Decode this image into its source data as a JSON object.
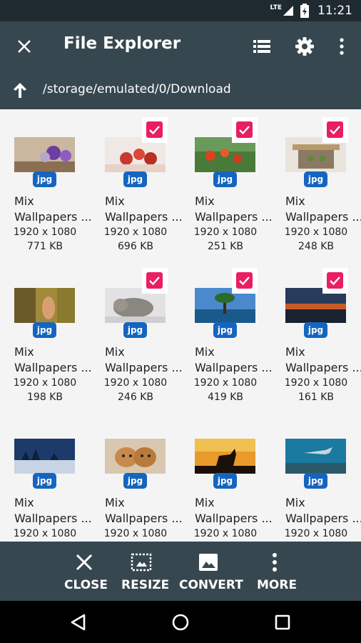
{
  "status_bar": {
    "network": "LTE",
    "time": "11:21"
  },
  "app_bar": {
    "title": "File Explorer",
    "icons": [
      "close-icon",
      "list-view-icon",
      "gear-icon",
      "more-vert-icon"
    ]
  },
  "path_bar": {
    "path": "/storage/emulated/0/Download",
    "icon": "arrow-up-icon"
  },
  "files": [
    {
      "name1": "Mix",
      "name2": "Wallpapers ...",
      "resolution": "1920 x 1080",
      "size": "771 KB",
      "type": "jpg",
      "checked": false
    },
    {
      "name1": "Mix",
      "name2": "Wallpapers ...",
      "resolution": "1920 x 1080",
      "size": "696 KB",
      "type": "jpg",
      "checked": true
    },
    {
      "name1": "Mix",
      "name2": "Wallpapers ...",
      "resolution": "1920 x 1080",
      "size": "251 KB",
      "type": "jpg",
      "checked": true
    },
    {
      "name1": "Mix",
      "name2": "Wallpapers ...",
      "resolution": "1920 x 1080",
      "size": "248 KB",
      "type": "jpg",
      "checked": true
    },
    {
      "name1": "Mix",
      "name2": "Wallpapers ...",
      "resolution": "1920 x 1080",
      "size": "198 KB",
      "type": "jpg",
      "checked": false
    },
    {
      "name1": "Mix",
      "name2": "Wallpapers ...",
      "resolution": "1920 x 1080",
      "size": "246 KB",
      "type": "jpg",
      "checked": true
    },
    {
      "name1": "Mix",
      "name2": "Wallpapers ...",
      "resolution": "1920 x 1080",
      "size": "419 KB",
      "type": "jpg",
      "checked": true
    },
    {
      "name1": "Mix",
      "name2": "Wallpapers ...",
      "resolution": "1920 x 1080",
      "size": "161 KB",
      "type": "jpg",
      "checked": true
    },
    {
      "name1": "Mix",
      "name2": "Wallpapers ...",
      "resolution": "1920 x 1080",
      "size": "",
      "type": "jpg",
      "checked": false
    },
    {
      "name1": "Mix",
      "name2": "Wallpapers ...",
      "resolution": "1920 x 1080",
      "size": "",
      "type": "jpg",
      "checked": false
    },
    {
      "name1": "Mix",
      "name2": "Wallpapers ...",
      "resolution": "1920 x 1080",
      "size": "",
      "type": "jpg",
      "checked": false
    },
    {
      "name1": "Mix",
      "name2": "Wallpapers ...",
      "resolution": "1920 x 1080",
      "size": "",
      "type": "jpg",
      "checked": false
    }
  ],
  "bottom_actions": [
    {
      "label": "CLOSE",
      "icon": "close-icon"
    },
    {
      "label": "RESIZE",
      "icon": "resize-icon"
    },
    {
      "label": "CONVERT",
      "icon": "image-icon"
    },
    {
      "label": "MORE",
      "icon": "more-vert-icon"
    }
  ],
  "nav_bar": {
    "icons": [
      "back-icon",
      "home-icon",
      "recents-icon"
    ]
  },
  "colors": {
    "toolbar": "#37474f",
    "status_bar": "#1f2a30",
    "check": "#e91e63",
    "badge": "#1565c0"
  }
}
